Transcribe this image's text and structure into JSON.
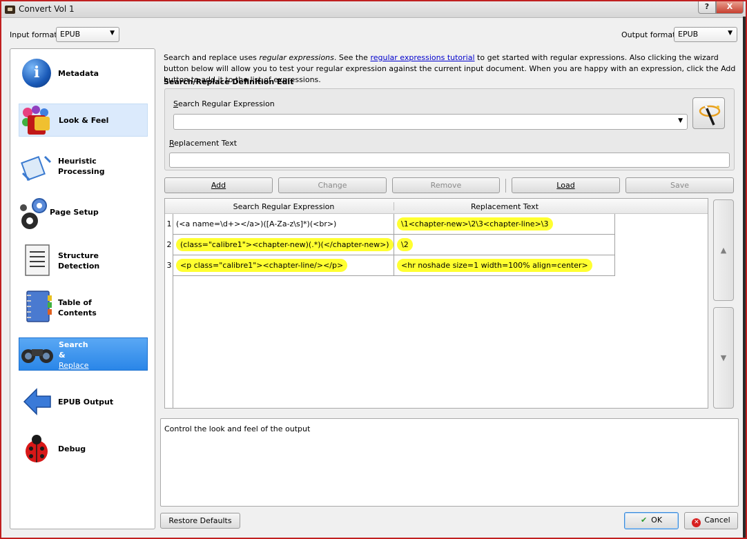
{
  "window": {
    "title": "Convert Vol 1",
    "help_label": "?",
    "close_label": "X"
  },
  "input_format": {
    "label": "Input format:",
    "value": "EPUB"
  },
  "output_format": {
    "label": "Output format:",
    "value": "EPUB"
  },
  "sidebar": {
    "items": [
      {
        "label1": "Metadata",
        "label2": ""
      },
      {
        "label1": "Look & Feel",
        "label2": ""
      },
      {
        "label1": "Heuristic",
        "label2": "Processing"
      },
      {
        "label1": "Page Setup",
        "label2": ""
      },
      {
        "label1": "Structure",
        "label2": "Detection"
      },
      {
        "label1": "Table of",
        "label2": "Contents"
      },
      {
        "label1": "Search",
        "label2": "&",
        "label3": "Replace"
      },
      {
        "label1": "EPUB Output",
        "label2": ""
      },
      {
        "label1": "Debug",
        "label2": ""
      }
    ]
  },
  "intro": {
    "text1": "Search and replace uses ",
    "em": "regular expressions",
    "text2": ". See the ",
    "link": "regular expressions tutorial",
    "text3": " to get started with regular expressions. Also clicking the wizard button below will allow you to test your regular expression against the current input document. When you are happy with an expression, click the Add button to add it to the list of expressions."
  },
  "definition": {
    "title": "Search/Replace Definition Edit",
    "search_label": "Search Regular Expression",
    "search_value": "",
    "replacement_label": "Replacement Text",
    "replacement_value": ""
  },
  "buttons": {
    "add": "Add",
    "change": "Change",
    "remove": "Remove",
    "load": "Load",
    "save": "Save"
  },
  "table": {
    "headers": [
      "Search Regular Expression",
      "Replacement Text"
    ],
    "rows": [
      {
        "num": "1",
        "search": "(<a name=\\d+></a>)([A-Za-z\\s]*)(<br>)",
        "replace": "\\1<chapter-new>\\2\\3<chapter-line>\\3"
      },
      {
        "num": "2",
        "search": " (class=\"calibre1\"><chapter-new)(.*)(</chapter-new>)",
        "replace": "\\2"
      },
      {
        "num": "3",
        "search": "<p class=\"calibre1\"><chapter-line/></p>",
        "replace": "<hr noshade size=1 width=100% align=center>"
      }
    ]
  },
  "scroll": {
    "up": "▲",
    "down": "▼"
  },
  "description": "Control the look and feel of the output",
  "footer": {
    "restore": "Restore Defaults",
    "ok": "OK",
    "cancel": "Cancel"
  },
  "colors": {
    "highlight": "#ffff30",
    "selected_bg": "#2a86e8"
  }
}
